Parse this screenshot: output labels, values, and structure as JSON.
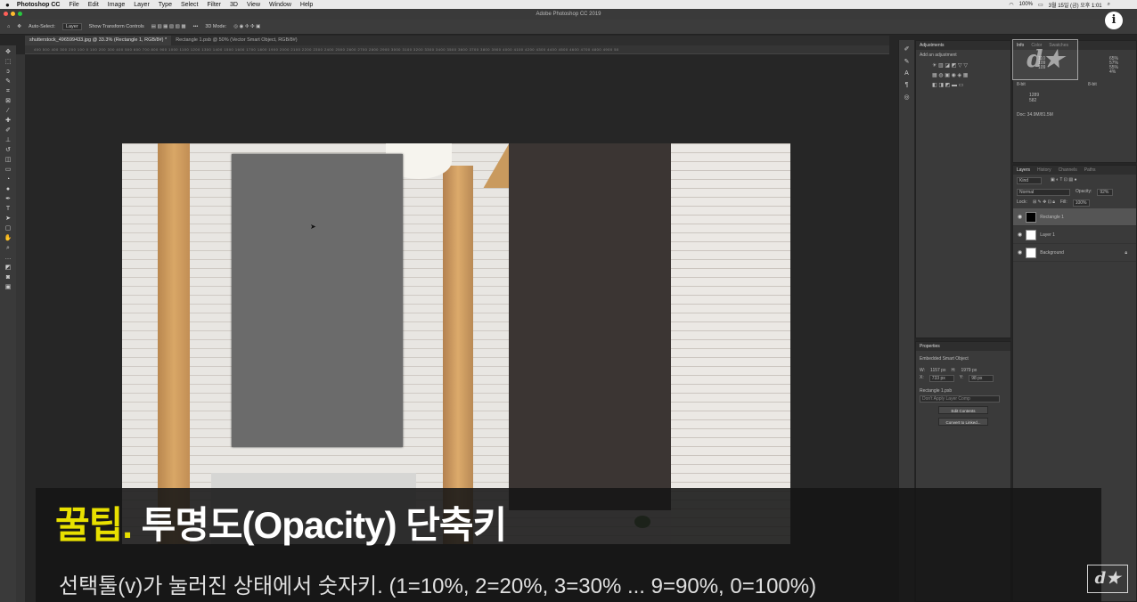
{
  "menubar": {
    "apple": "",
    "app_name": "Photoshop CC",
    "items": [
      "File",
      "Edit",
      "Image",
      "Layer",
      "Type",
      "Select",
      "Filter",
      "3D",
      "View",
      "Window",
      "Help"
    ],
    "status": "100%",
    "clock": "3월 15일 (금) 오후 1:01"
  },
  "window": {
    "title": "Adobe Photoshop CC 2019"
  },
  "options": {
    "auto_select_label": "Auto-Select:",
    "auto_select_value": "Layer",
    "transform_label": "Show Transform Controls",
    "mode_label": "3D Mode:"
  },
  "tabs": [
    {
      "label": "shutterstock_496599433.jpg @ 33.3% (Rectangle 1, RGB/8#) *",
      "active": true
    },
    {
      "label": "Rectangle 1.psb @ 50% (Vector Smart Object, RGB/8#)",
      "active": false
    }
  ],
  "ruler": {
    "ticks": "400 500 400 300 200 100 0 100 200 300 400 500 600 700 800 900 1000 1100 1200 1300 1400 1500 1600 1700 1800 1900 2000 2100 2200 2300 2400 2500 2600 2700 2800 2900 3000 3100 3200 3300 3400 3500 3600 3700 3800 3900 4000 4100 4200 4300 4400 4500 4600 4700 4800 4900 50"
  },
  "adjustments": {
    "title": "Adjustments",
    "subtitle": "Add an adjustment"
  },
  "info": {
    "tabs": [
      "Info",
      "Color",
      "Swatches"
    ],
    "rgb": {
      "r": "110",
      "g": "109",
      "b": "109"
    },
    "cmyk": {
      "c": "65%",
      "m": "57%",
      "y": "55%",
      "k": "4%"
    },
    "bit_left": "8-bit",
    "bit_right": "8-bit",
    "x": "1289",
    "y": "582",
    "doc": "Doc: 34.9M/81.5M"
  },
  "layers_panel": {
    "tabs": [
      "Layers",
      "History",
      "Channels",
      "Paths"
    ],
    "filter": "Kind",
    "blend_mode": "Normal",
    "opacity_label": "Opacity:",
    "opacity_value": "92%",
    "lock_label": "Lock:",
    "fill_label": "Fill:",
    "fill_value": "100%",
    "layers": [
      {
        "name": "Rectangle 1",
        "active": true
      },
      {
        "name": "Layer 1",
        "active": false
      },
      {
        "name": "Background",
        "active": false
      }
    ]
  },
  "properties": {
    "title": "Properties",
    "type": "Embedded Smart Object",
    "w_label": "W:",
    "w_value": "1157 px",
    "h_label": "H:",
    "h_value": "1979 px",
    "x_label": "X:",
    "x_value": "733 px",
    "y_label": "Y:",
    "y_value": "98 px",
    "file": "Rectangle 1.psb",
    "layer_comp": "Don't Apply Layer Comp",
    "edit_contents": "Edit Contents",
    "convert_linked": "Convert to Linked..."
  },
  "logo": {
    "text": "d★"
  },
  "info_button": "i",
  "caption": {
    "tip": "꿀팁.",
    "headline": "투명도(Opacity) 단축키",
    "sub": "선택툴(v)가 눌러진 상태에서 숫자키. (1=10%, 2=20%, 3=30% ... 9=90%, 0=100%)"
  }
}
